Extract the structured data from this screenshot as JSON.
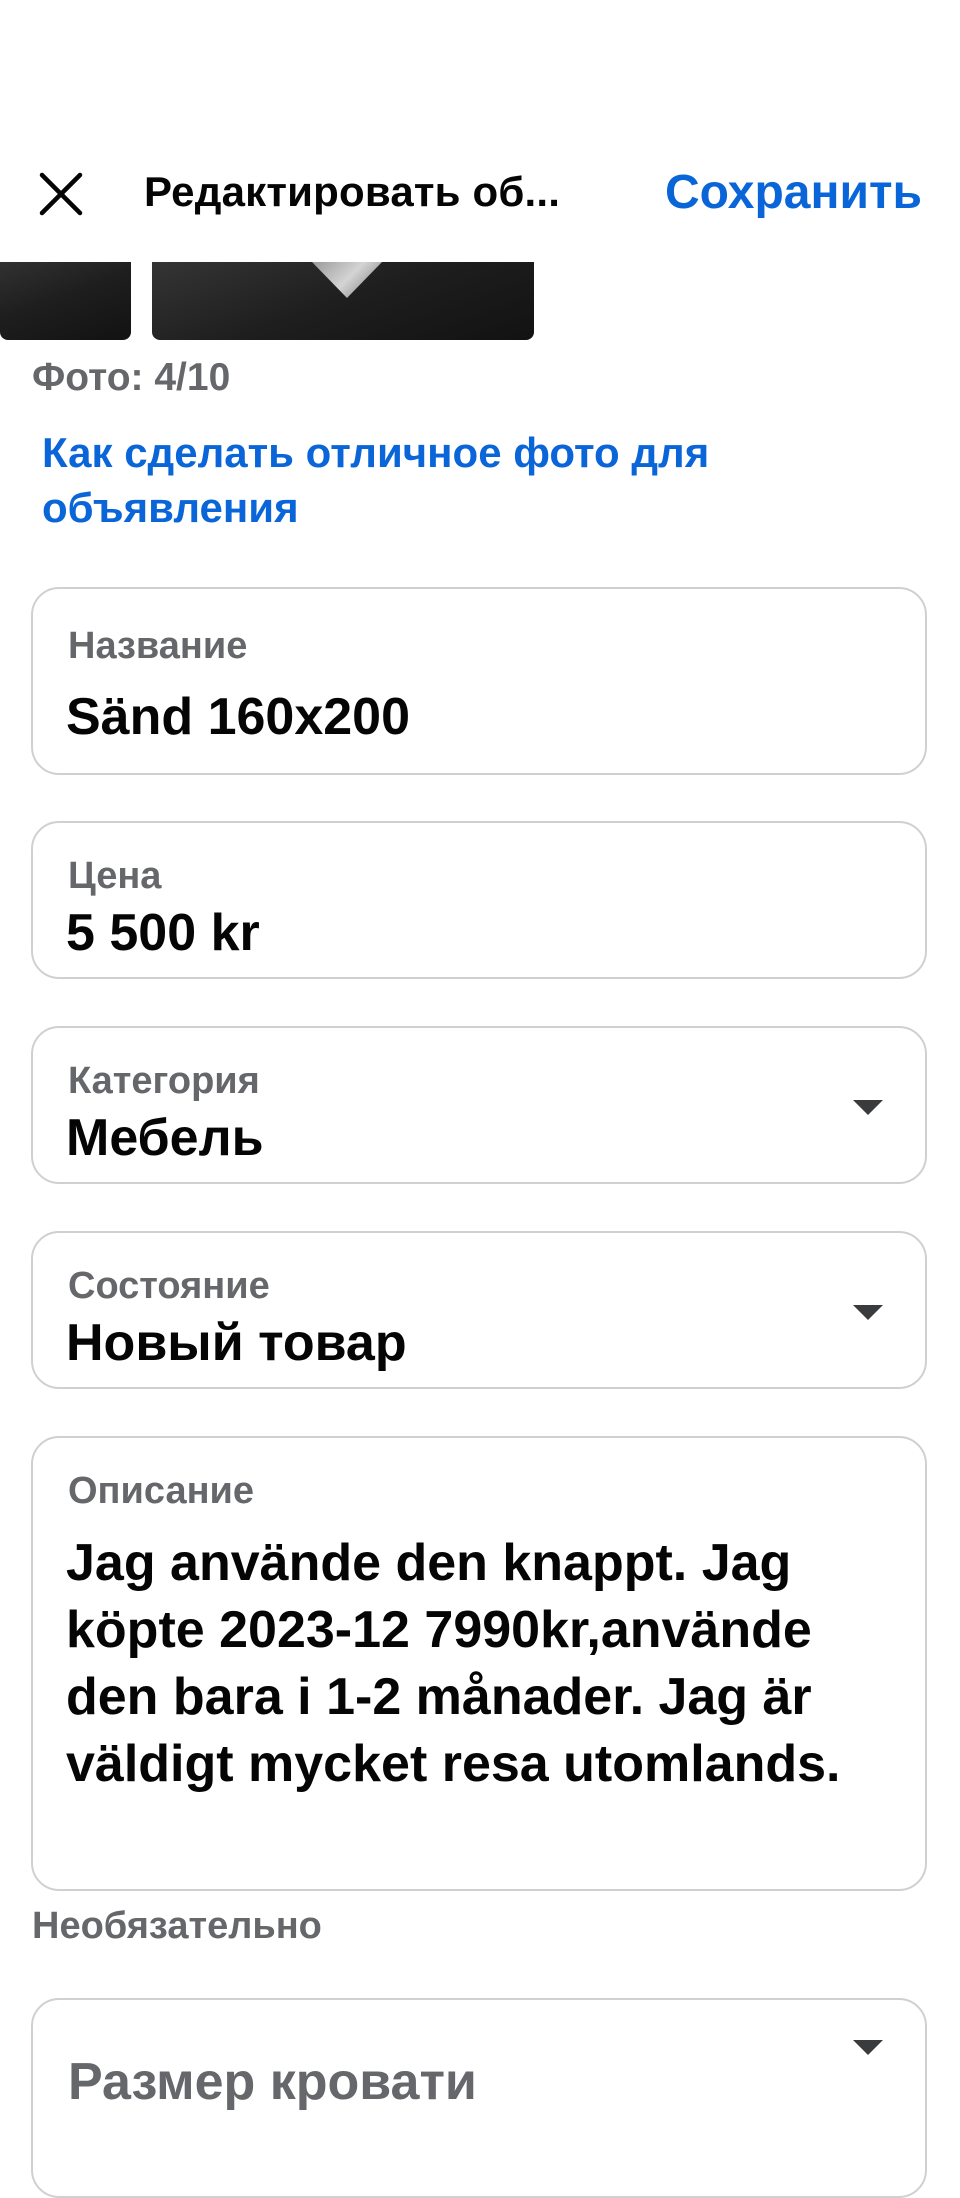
{
  "header": {
    "title": "Редактировать об...",
    "save_label": "Сохранить",
    "close_icon": "close-icon"
  },
  "photos": {
    "count_label": "Фото: 4/10",
    "tip_link": "Как сделать отличное фото для объявления"
  },
  "fields": {
    "title": {
      "label": "Название",
      "value": "Sänd 160x200"
    },
    "price": {
      "label": "Цена",
      "value": "5 500 kr"
    },
    "category": {
      "label": "Категория",
      "value": "Мебель",
      "icon": "caret-down-icon"
    },
    "condition": {
      "label": "Состояние",
      "value": "Новый товар",
      "icon": "caret-down-icon"
    },
    "description": {
      "label": "Описание",
      "value": "Jag använde den knappt. Jag köpte 2023-12 7990kr,använde den bara i 1-2 månader. Jag är väldigt mycket resa utomlands."
    },
    "optional_label": "Необязательно",
    "bed_size": {
      "label": "Размер кровати",
      "icon": "caret-down-icon"
    }
  },
  "colors": {
    "accent": "#0a66d8",
    "secondary_text": "#65676b",
    "border": "#ced0d4"
  }
}
